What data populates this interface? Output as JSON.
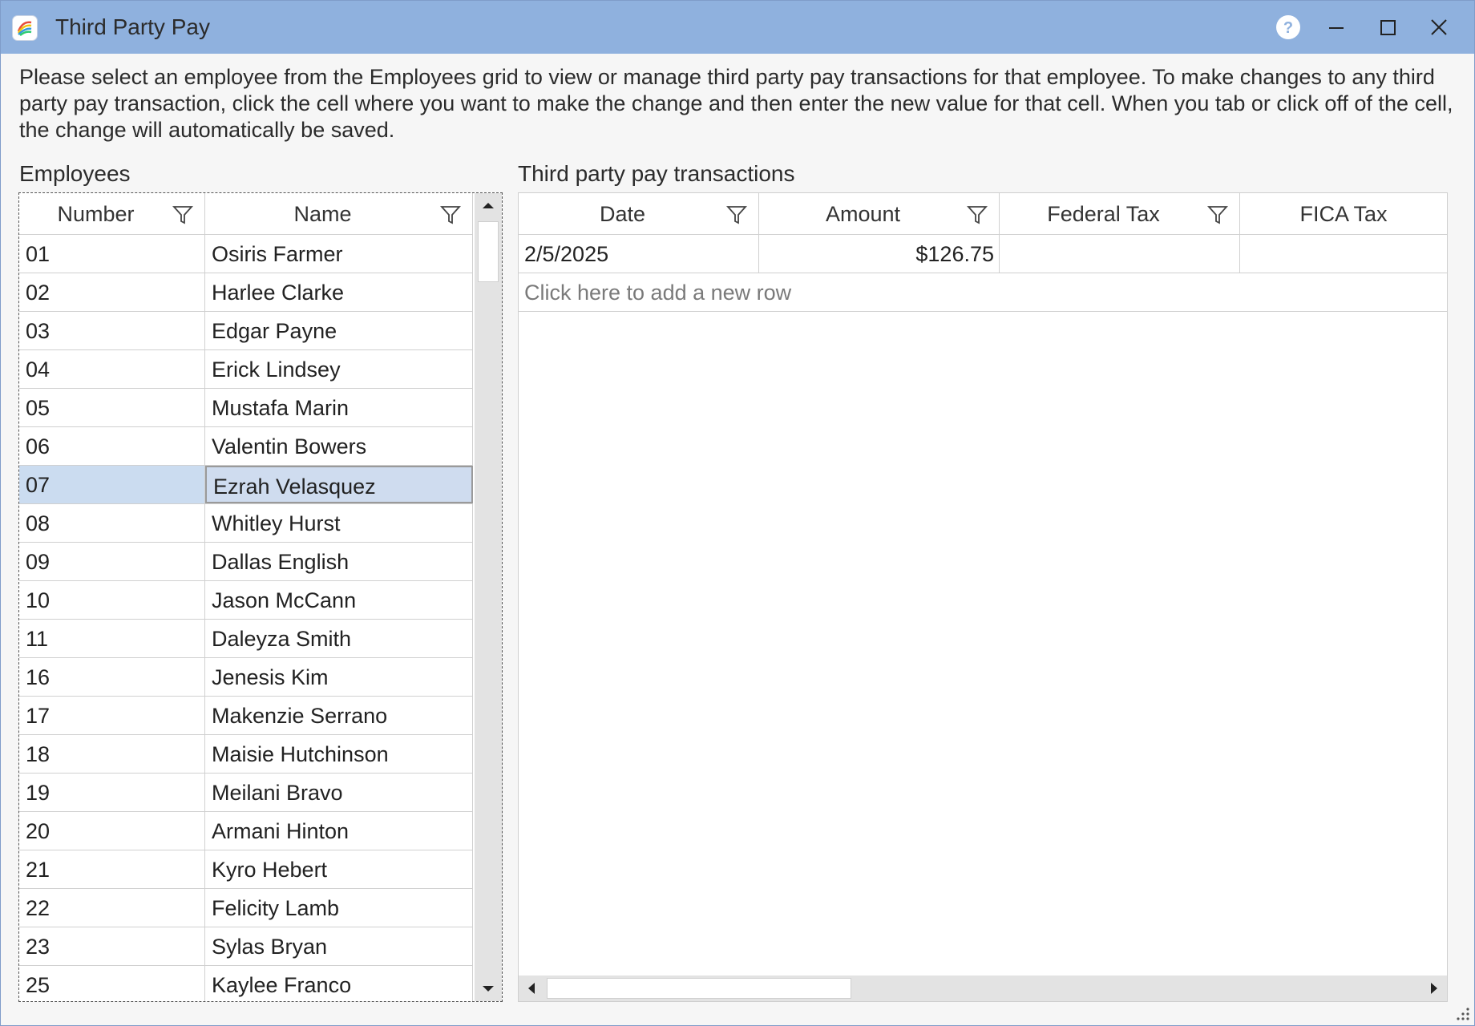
{
  "window": {
    "title": "Third Party Pay",
    "controls": [
      "help-icon",
      "minimize-icon",
      "maximize-icon",
      "close-icon"
    ]
  },
  "description": "Please select an employee from the Employees grid to view or manage third party pay transactions for that employee. To make changes to any third party pay transaction, click the cell where you want to make the change and then enter the new value for that cell. When you tab or click off of the cell, the change will automatically be saved.",
  "employees": {
    "label": "Employees",
    "columns": [
      "Number",
      "Name"
    ],
    "rows": [
      {
        "number": "01",
        "name": "Osiris Farmer"
      },
      {
        "number": "02",
        "name": "Harlee Clarke"
      },
      {
        "number": "03",
        "name": "Edgar Payne"
      },
      {
        "number": "04",
        "name": "Erick Lindsey"
      },
      {
        "number": "05",
        "name": "Mustafa Marin"
      },
      {
        "number": "06",
        "name": "Valentin Bowers"
      },
      {
        "number": "07",
        "name": "Ezrah Velasquez"
      },
      {
        "number": "08",
        "name": "Whitley Hurst"
      },
      {
        "number": "09",
        "name": "Dallas English"
      },
      {
        "number": "10",
        "name": "Jason McCann"
      },
      {
        "number": "11",
        "name": "Daleyza Smith"
      },
      {
        "number": "16",
        "name": "Jenesis Kim"
      },
      {
        "number": "17",
        "name": "Makenzie Serrano"
      },
      {
        "number": "18",
        "name": "Maisie Hutchinson"
      },
      {
        "number": "19",
        "name": "Meilani Bravo"
      },
      {
        "number": "20",
        "name": "Armani Hinton"
      },
      {
        "number": "21",
        "name": "Kyro Hebert"
      },
      {
        "number": "22",
        "name": "Felicity Lamb"
      },
      {
        "number": "23",
        "name": "Sylas Bryan"
      },
      {
        "number": "25",
        "name": "Kaylee Franco"
      }
    ],
    "selected_index": 6
  },
  "transactions": {
    "label": "Third party pay transactions",
    "columns": [
      "Date",
      "Amount",
      "Federal Tax",
      "FICA Tax"
    ],
    "rows": [
      {
        "date": "2/5/2025",
        "amount": "$126.75",
        "federal_tax": "",
        "fica_tax": ""
      }
    ],
    "new_row_text": "Click here to add a new row"
  },
  "colors": {
    "titlebar": "#8fb1de",
    "selected_row": "#cbdcf0"
  }
}
